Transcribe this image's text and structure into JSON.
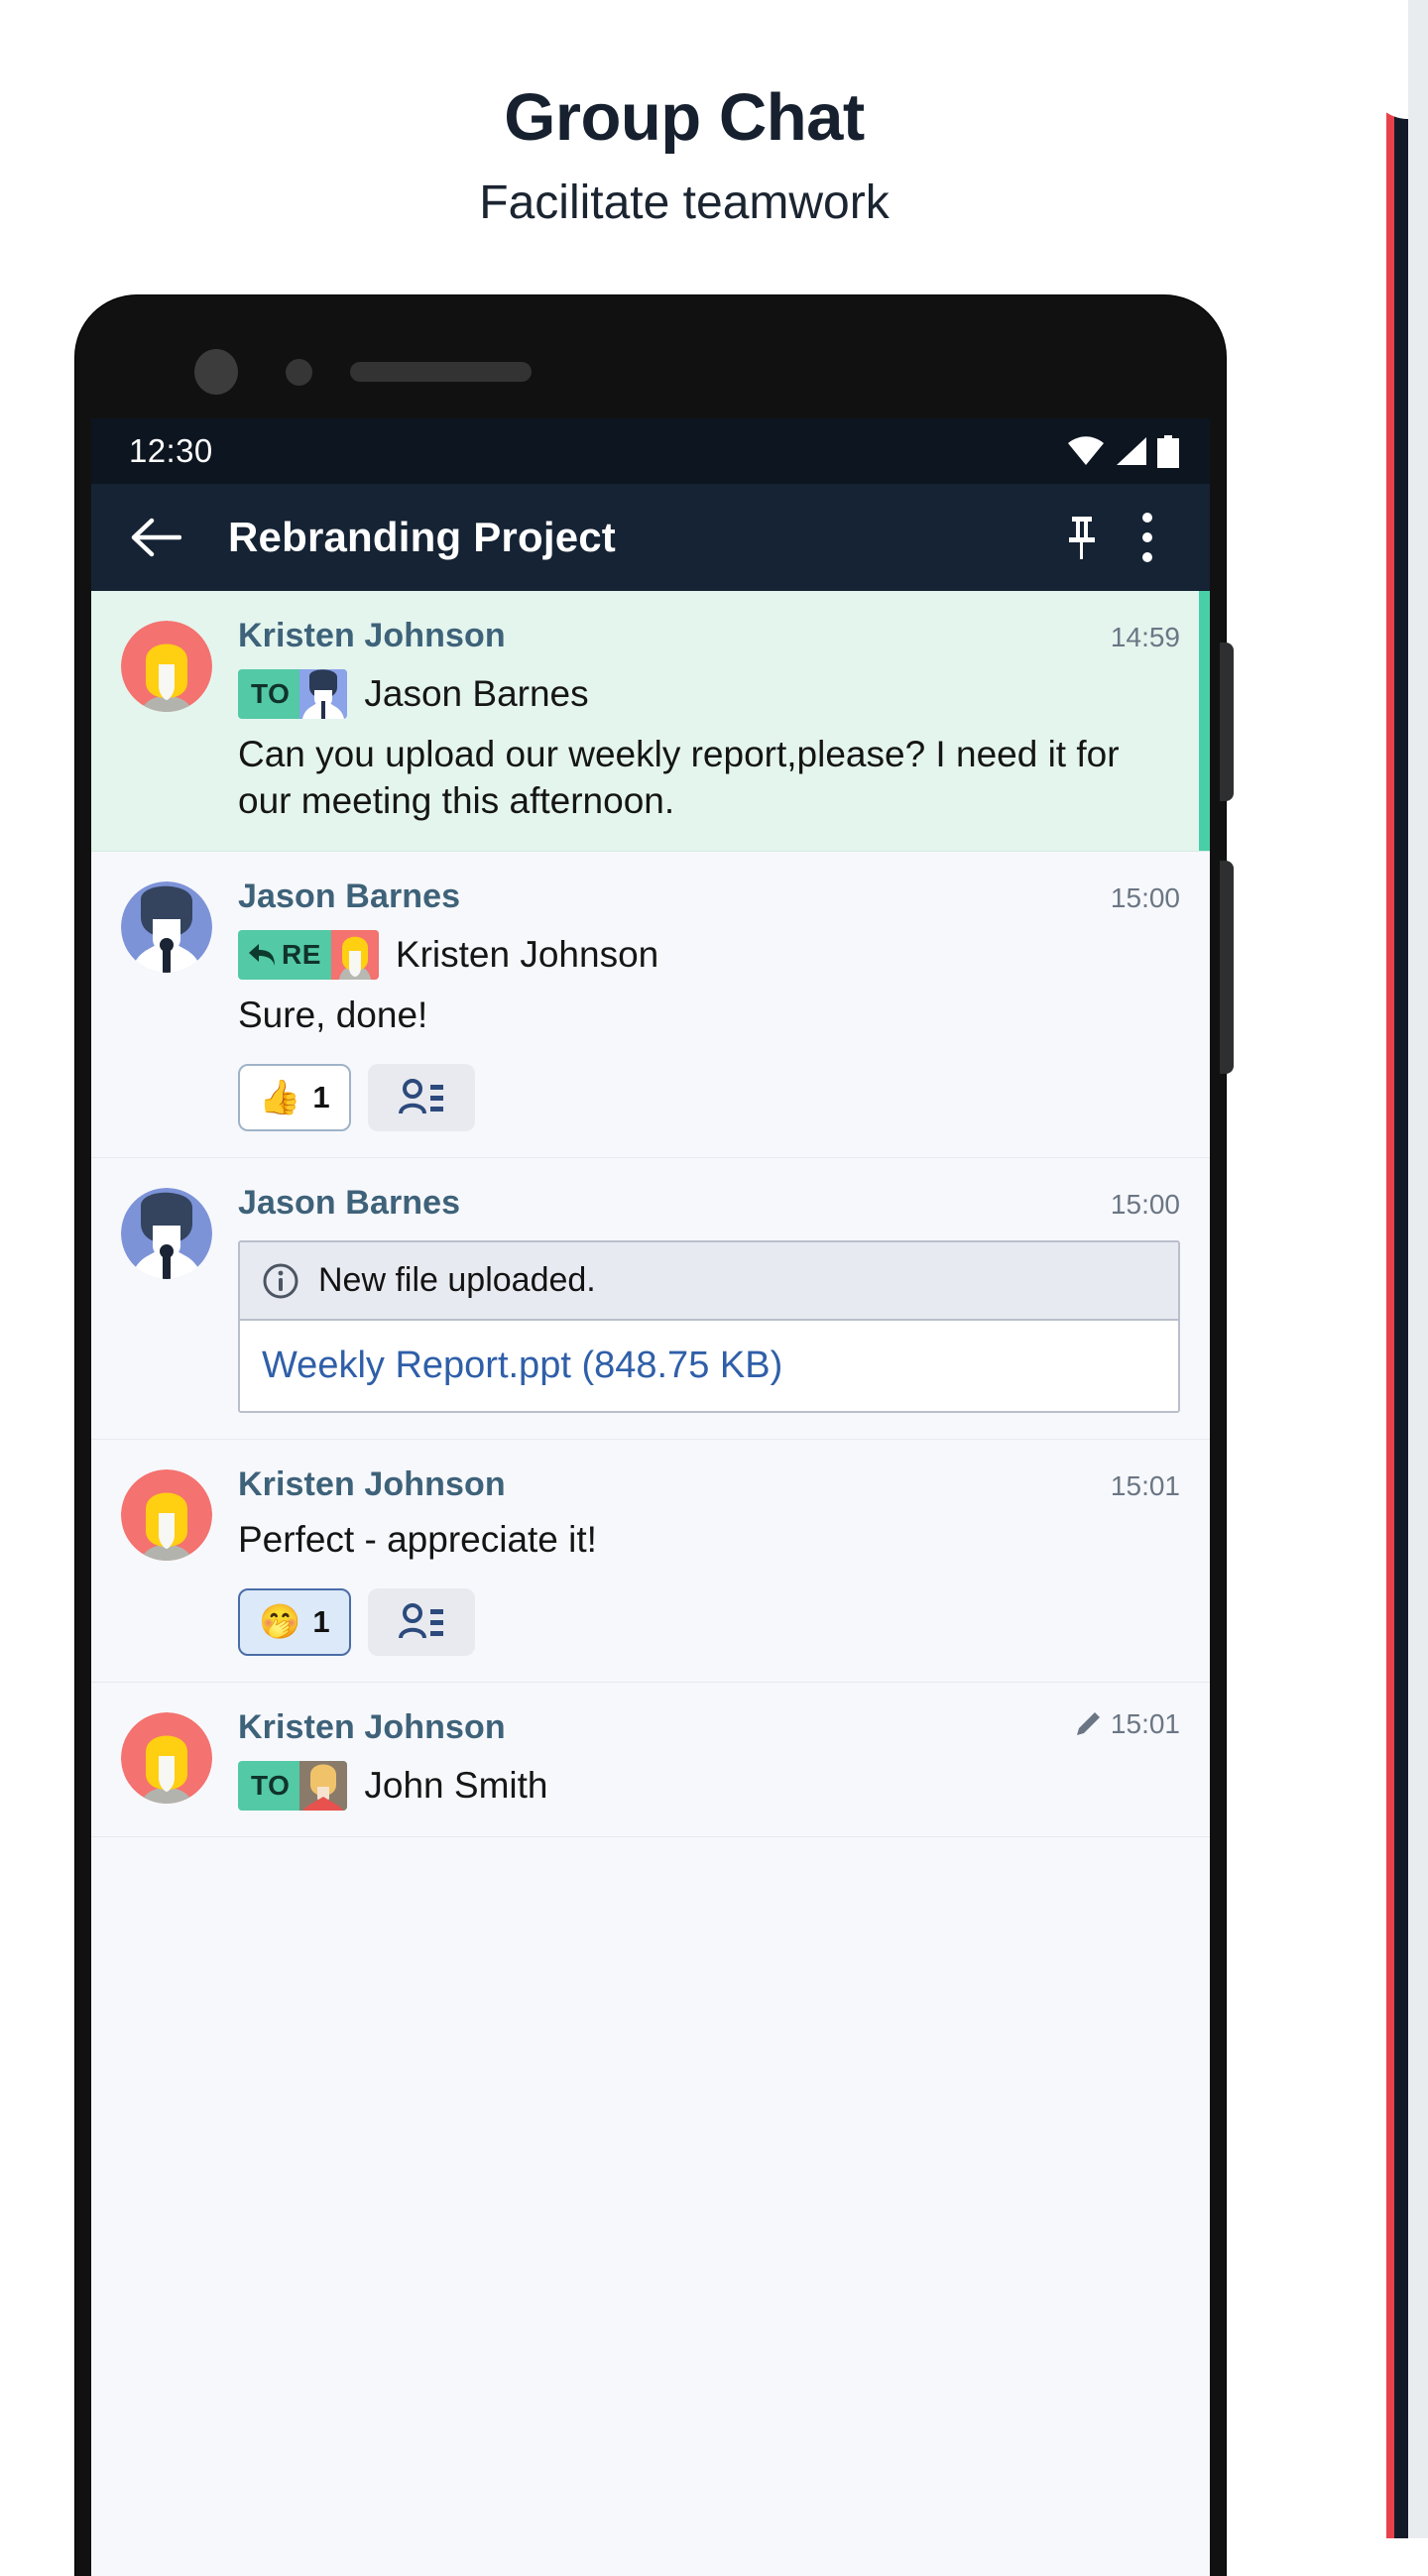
{
  "promo": {
    "title": "Group Chat",
    "subtitle": "Facilitate teamwork"
  },
  "phone": {
    "status_bar": {
      "time": "12:30",
      "icons": [
        "wifi-icon",
        "cellular-signal-icon",
        "battery-icon"
      ]
    },
    "app_bar": {
      "back_icon": "back-arrow-icon",
      "title": "Rebranding Project",
      "pin_icon": "pin-icon",
      "overflow_icon": "more-vertical-icon"
    },
    "messages": [
      {
        "sender": "Kristen Johnson",
        "time": "14:59",
        "edited": false,
        "highlight": true,
        "avatar": "kristen-avatar",
        "badge": {
          "type": "to",
          "label": "TO",
          "avatar": "jason-avatar"
        },
        "recipient": "Jason Barnes",
        "text": "Can you upload our weekly report,please? I need it for our meeting this afternoon.",
        "reactions": []
      },
      {
        "sender": "Jason Barnes",
        "time": "15:00",
        "edited": false,
        "highlight": false,
        "avatar": "jason-avatar",
        "badge": {
          "type": "re",
          "label": "RE",
          "avatar": "kristen-avatar"
        },
        "recipient": "Kristen Johnson",
        "text": "Sure, done!",
        "reactions": [
          {
            "emoji": "👍",
            "count": "1",
            "active": false
          },
          {
            "icon": "readers-icon"
          }
        ]
      },
      {
        "sender": "Jason Barnes",
        "time": "15:00",
        "edited": false,
        "highlight": false,
        "avatar": "jason-avatar",
        "file": {
          "info_icon": "info-circle-icon",
          "info_text": "New file uploaded.",
          "link_text": "Weekly Report.ppt (848.75 KB)"
        }
      },
      {
        "sender": "Kristen Johnson",
        "time": "15:01",
        "edited": false,
        "highlight": false,
        "avatar": "kristen-avatar",
        "text": "Perfect - appreciate it!",
        "reactions": [
          {
            "emoji": "🤭",
            "count": "1",
            "active": true
          },
          {
            "icon": "readers-icon"
          }
        ]
      },
      {
        "sender": "Kristen Johnson",
        "time": "15:01",
        "edited": true,
        "edit_icon": "pencil-icon",
        "highlight": false,
        "avatar": "kristen-avatar",
        "badge": {
          "type": "to",
          "label": "TO",
          "avatar": "john-avatar"
        },
        "recipient": "John Smith"
      }
    ]
  },
  "colors": {
    "accent_teal": "#49cfa7",
    "app_bar_navy": "#152334",
    "status_bar_navy": "#0d1520",
    "sender_blue": "#3e6279",
    "link_blue": "#2f5fa8",
    "highlight_bg": "#e4f5ee",
    "edge_red": "#e8414c"
  }
}
